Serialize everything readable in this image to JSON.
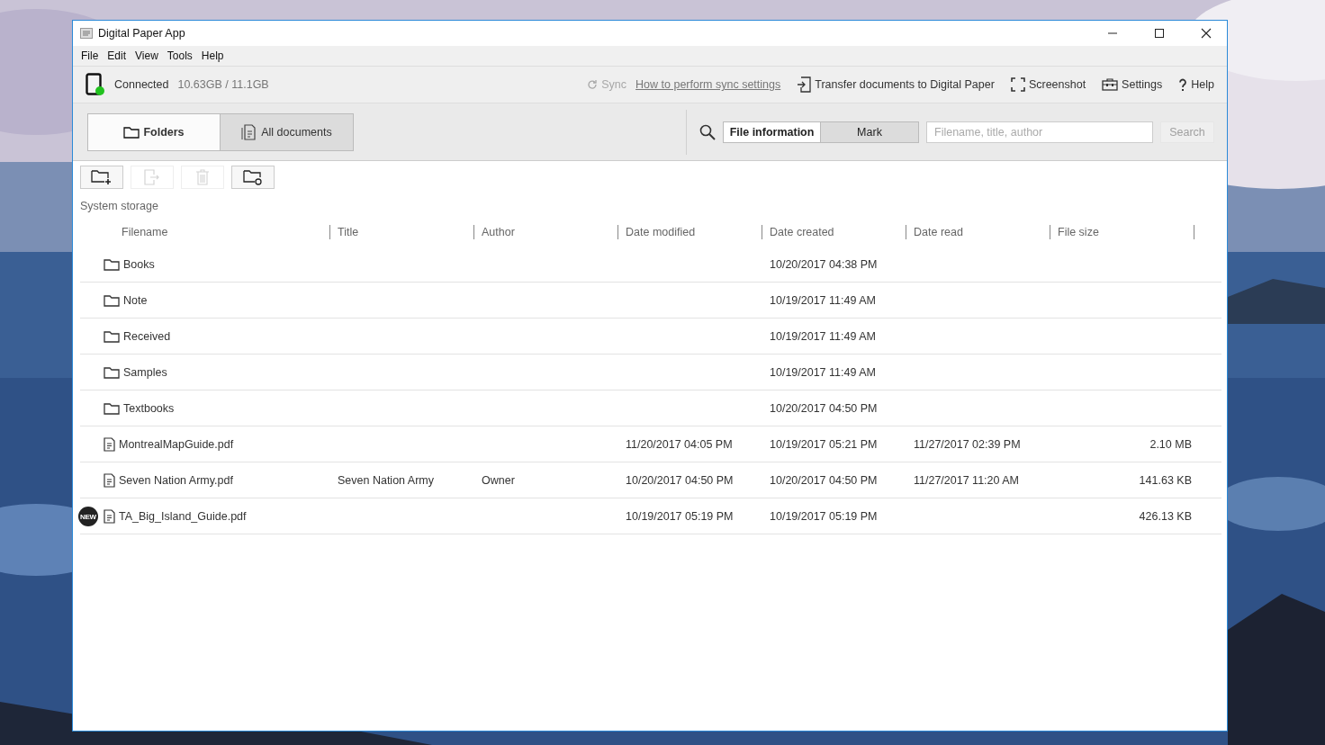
{
  "window": {
    "title": "Digital Paper App"
  },
  "menu": [
    "File",
    "Edit",
    "View",
    "Tools",
    "Help"
  ],
  "status_bar": {
    "status": "Connected",
    "storage": "10.63GB / 11.1GB",
    "connected": true,
    "sync": {
      "label": "Sync",
      "disabled": true
    },
    "link": "How to perform sync settings",
    "actions": [
      {
        "kind": "transfer",
        "label": "Transfer documents to Digital Paper"
      },
      {
        "kind": "screenshot",
        "label": "Screenshot"
      },
      {
        "kind": "settings",
        "label": "Settings"
      },
      {
        "kind": "help",
        "label": "Help"
      }
    ]
  },
  "tabs": [
    {
      "kind": "folders",
      "label": "Folders",
      "selected": true
    },
    {
      "kind": "documents",
      "label": "All documents",
      "selected": false
    }
  ],
  "search": {
    "modes": [
      {
        "label": "File information",
        "selected": true
      },
      {
        "label": "Mark",
        "selected": false
      }
    ],
    "placeholder": "Filename, title, author",
    "button": {
      "label": "Search",
      "disabled": true
    }
  },
  "toolbar": [
    {
      "kind": "new-folder",
      "disabled": false
    },
    {
      "kind": "move",
      "disabled": true
    },
    {
      "kind": "delete",
      "disabled": true
    },
    {
      "kind": "sync-folder",
      "disabled": false
    }
  ],
  "location": "System storage",
  "table": {
    "columns": [
      "Filename",
      "Title",
      "Author",
      "Date modified",
      "Date created",
      "Date read",
      "File size"
    ],
    "rows": [
      {
        "kind": "folder",
        "cells": [
          "Books",
          "",
          "",
          "",
          "10/20/2017 04:38 PM",
          "",
          ""
        ]
      },
      {
        "kind": "folder",
        "cells": [
          "Note",
          "",
          "",
          "",
          "10/19/2017 11:49 AM",
          "",
          ""
        ]
      },
      {
        "kind": "folder",
        "cells": [
          "Received",
          "",
          "",
          "",
          "10/19/2017 11:49 AM",
          "",
          ""
        ]
      },
      {
        "kind": "folder",
        "cells": [
          "Samples",
          "",
          "",
          "",
          "10/19/2017 11:49 AM",
          "",
          ""
        ]
      },
      {
        "kind": "folder",
        "cells": [
          "Textbooks",
          "",
          "",
          "",
          "10/20/2017 04:50 PM",
          "",
          ""
        ]
      },
      {
        "kind": "file",
        "cells": [
          "MontrealMapGuide.pdf",
          "",
          "",
          "11/20/2017 04:05 PM",
          "10/19/2017 05:21 PM",
          "11/27/2017 02:39 PM",
          "2.10 MB"
        ]
      },
      {
        "kind": "file",
        "cells": [
          "Seven Nation Army.pdf",
          "Seven Nation Army",
          "Owner",
          "10/20/2017 04:50 PM",
          "10/20/2017 04:50 PM",
          "11/27/2017 11:20 AM",
          "141.63 KB"
        ]
      },
      {
        "kind": "file",
        "badge": "NEW",
        "cells": [
          "TA_Big_Island_Guide.pdf",
          "",
          "",
          "10/19/2017 05:19 PM",
          "10/19/2017 05:19 PM",
          "",
          "426.13 KB"
        ]
      }
    ]
  }
}
